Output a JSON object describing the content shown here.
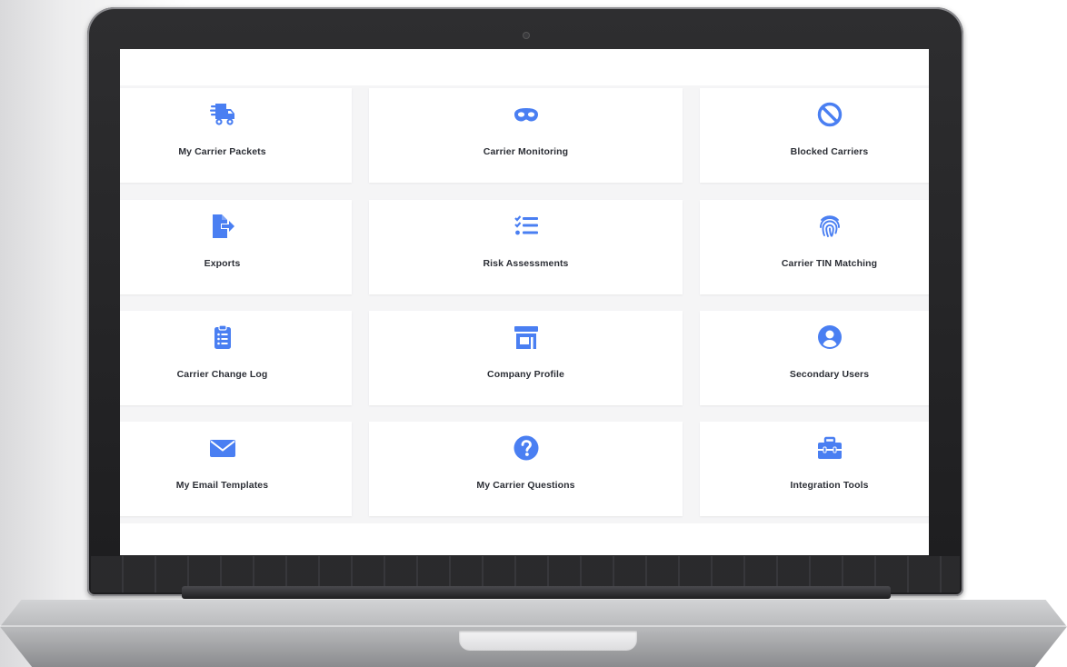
{
  "accent_color": "#4a7ff2",
  "dashboard": {
    "cards": [
      {
        "label": "My Carrier Packets",
        "icon": "truck-icon"
      },
      {
        "label": "Carrier Monitoring",
        "icon": "mask-icon"
      },
      {
        "label": "Blocked Carriers",
        "icon": "block-icon"
      },
      {
        "label": "Exports",
        "icon": "file-export-icon"
      },
      {
        "label": "Risk Assessments",
        "icon": "checklist-icon"
      },
      {
        "label": "Carrier TIN Matching",
        "icon": "fingerprint-icon"
      },
      {
        "label": "Carrier Change Log",
        "icon": "clipboard-list-icon"
      },
      {
        "label": "Company Profile",
        "icon": "storefront-icon"
      },
      {
        "label": "Secondary Users",
        "icon": "user-circle-icon"
      },
      {
        "label": "My Email Templates",
        "icon": "envelope-icon"
      },
      {
        "label": "My Carrier Questions",
        "icon": "question-circle-icon"
      },
      {
        "label": "Integration Tools",
        "icon": "toolbox-icon"
      }
    ]
  }
}
